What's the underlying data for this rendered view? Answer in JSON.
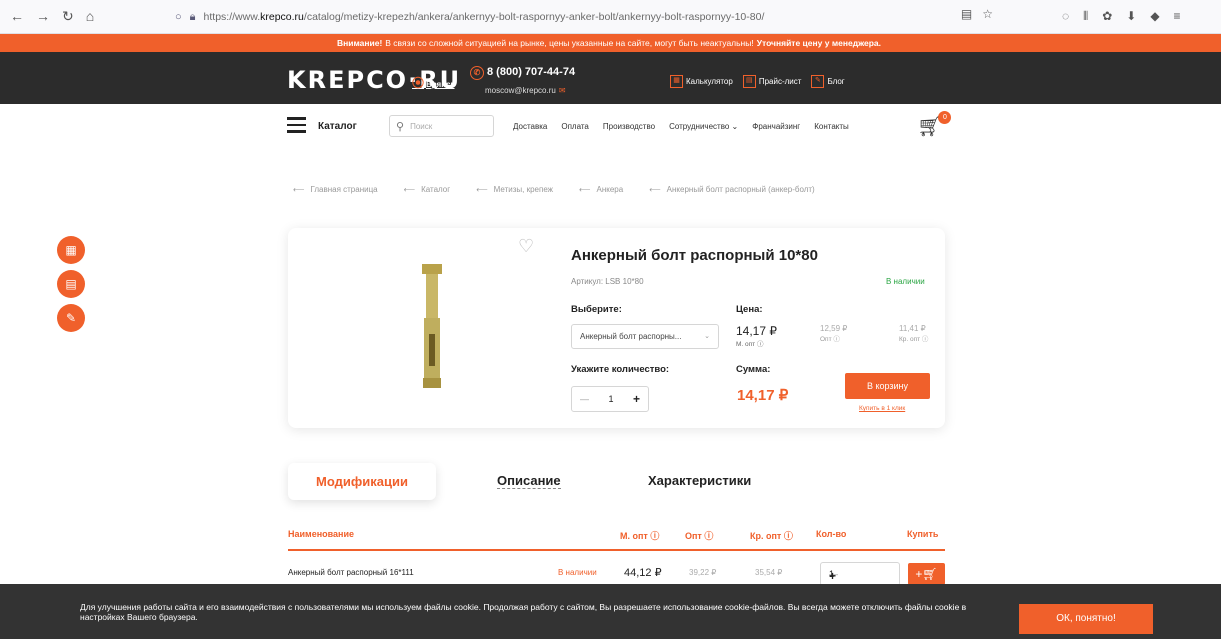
{
  "browser": {
    "url_prefix": "https://www.",
    "url_domain": "krepco.ru",
    "url_path": "/catalog/metizy-krepezh/ankera/ankernyy-bolt-raspornyy-anker-bolt/ankernyy-bolt-raspornyy-10-80/"
  },
  "notice": {
    "warning": "Внимание!",
    "text": "В связи со сложной ситуацией на рынке, цены указанные на сайте, могут быть неактуальны!",
    "cta": "Уточняйте цену у менеджера."
  },
  "header": {
    "logo": "KREPCO·RU",
    "city": "Брянск",
    "phone": "8 (800) 707-44-74",
    "email": "moscow@krepco.ru",
    "links": [
      "Калькулятор",
      "Прайс-лист",
      "Блог"
    ]
  },
  "nav": {
    "catalog": "Каталог",
    "search_placeholder": "Поиск",
    "menu": [
      "Доставка",
      "Оплата",
      "Производство",
      "Сотрудничество ⌄",
      "Франчайзинг",
      "Контакты"
    ],
    "cart_count": "0"
  },
  "breadcrumb": [
    "Главная страница",
    "Каталог",
    "Метизы, крепеж",
    "Анкера",
    "Анкерный болт распорный (анкер-болт)"
  ],
  "product": {
    "title": "Анкерный болт распорный 10*80",
    "sku": "Артикул: LSB 10*80",
    "stock": "В наличии",
    "choose_label": "Выберите:",
    "select_value": "Анкерный болт распорны...",
    "price_label": "Цена:",
    "prices": [
      {
        "value": "14,17 ₽",
        "type": "М. опт ⓘ"
      },
      {
        "value": "12,59 ₽",
        "type": "Опт ⓘ"
      },
      {
        "value": "11,41 ₽",
        "type": "Кр. опт ⓘ"
      }
    ],
    "qty_label": "Укажите количество:",
    "qty": "1",
    "sum_label": "Сумма:",
    "sum": "14,17 ₽",
    "buy_button": "В корзину",
    "one_click": "Купить в 1 клик"
  },
  "tabs": [
    "Модификации",
    "Описание",
    "Характеристики"
  ],
  "table": {
    "headers": [
      "Наименование",
      "М. опт ⓘ",
      "Опт ⓘ",
      "Кр. опт ⓘ",
      "Кол-во",
      "Купить"
    ],
    "rows": [
      {
        "name": "Анкерный болт распорный 16*111",
        "stock": "В наличии",
        "m_opt": "44,12 ₽",
        "opt": "39,22 ₽",
        "kr_opt": "35,54 ₽",
        "qty": "1"
      }
    ]
  },
  "cookie": {
    "text": "Для улучшения работы сайта и его взаимодействия с пользователями мы используем файлы cookie. Продолжая работу с сайтом, Вы разрешаете использование cookie-файлов. Вы всегда можете отключить файлы cookie в настройках Вашего браузера.",
    "button": "ОК, понятно!"
  },
  "colors": {
    "accent": "#f0602b",
    "header_bg": "#2c2c2c",
    "stock_green": "#2aa543"
  }
}
